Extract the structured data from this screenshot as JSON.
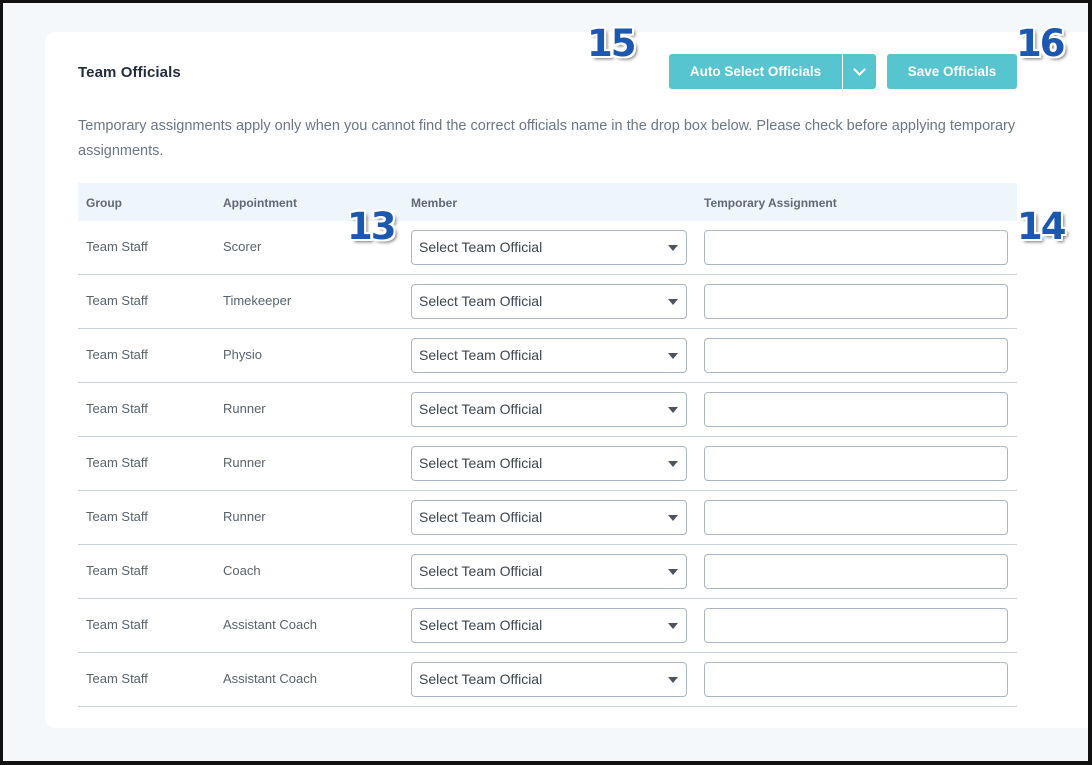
{
  "header": {
    "title": "Team Officials",
    "auto_select_label": "Auto Select Officials",
    "save_label": "Save Officials"
  },
  "description": "Temporary assignments apply only when you cannot find the correct officials name in the drop box below. Please check before applying temporary assignments.",
  "table": {
    "columns": [
      "Group",
      "Appointment",
      "Member",
      "Temporary Assignment"
    ],
    "rows": [
      {
        "group": "Team Staff",
        "appointment": "Scorer",
        "member": "Select Team Official",
        "temporary": ""
      },
      {
        "group": "Team Staff",
        "appointment": "Timekeeper",
        "member": "Select Team Official",
        "temporary": ""
      },
      {
        "group": "Team Staff",
        "appointment": "Physio",
        "member": "Select Team Official",
        "temporary": ""
      },
      {
        "group": "Team Staff",
        "appointment": "Runner",
        "member": "Select Team Official",
        "temporary": ""
      },
      {
        "group": "Team Staff",
        "appointment": "Runner",
        "member": "Select Team Official",
        "temporary": ""
      },
      {
        "group": "Team Staff",
        "appointment": "Runner",
        "member": "Select Team Official",
        "temporary": ""
      },
      {
        "group": "Team Staff",
        "appointment": "Coach",
        "member": "Select Team Official",
        "temporary": ""
      },
      {
        "group": "Team Staff",
        "appointment": "Assistant Coach",
        "member": "Select Team Official",
        "temporary": ""
      },
      {
        "group": "Team Staff",
        "appointment": "Assistant Coach",
        "member": "Select Team Official",
        "temporary": ""
      }
    ]
  },
  "annotations": [
    "13",
    "14",
    "15",
    "16"
  ],
  "colors": {
    "accent": "#57c5cf",
    "header_bg": "#eef5fb",
    "marker": "#1c57b0"
  }
}
